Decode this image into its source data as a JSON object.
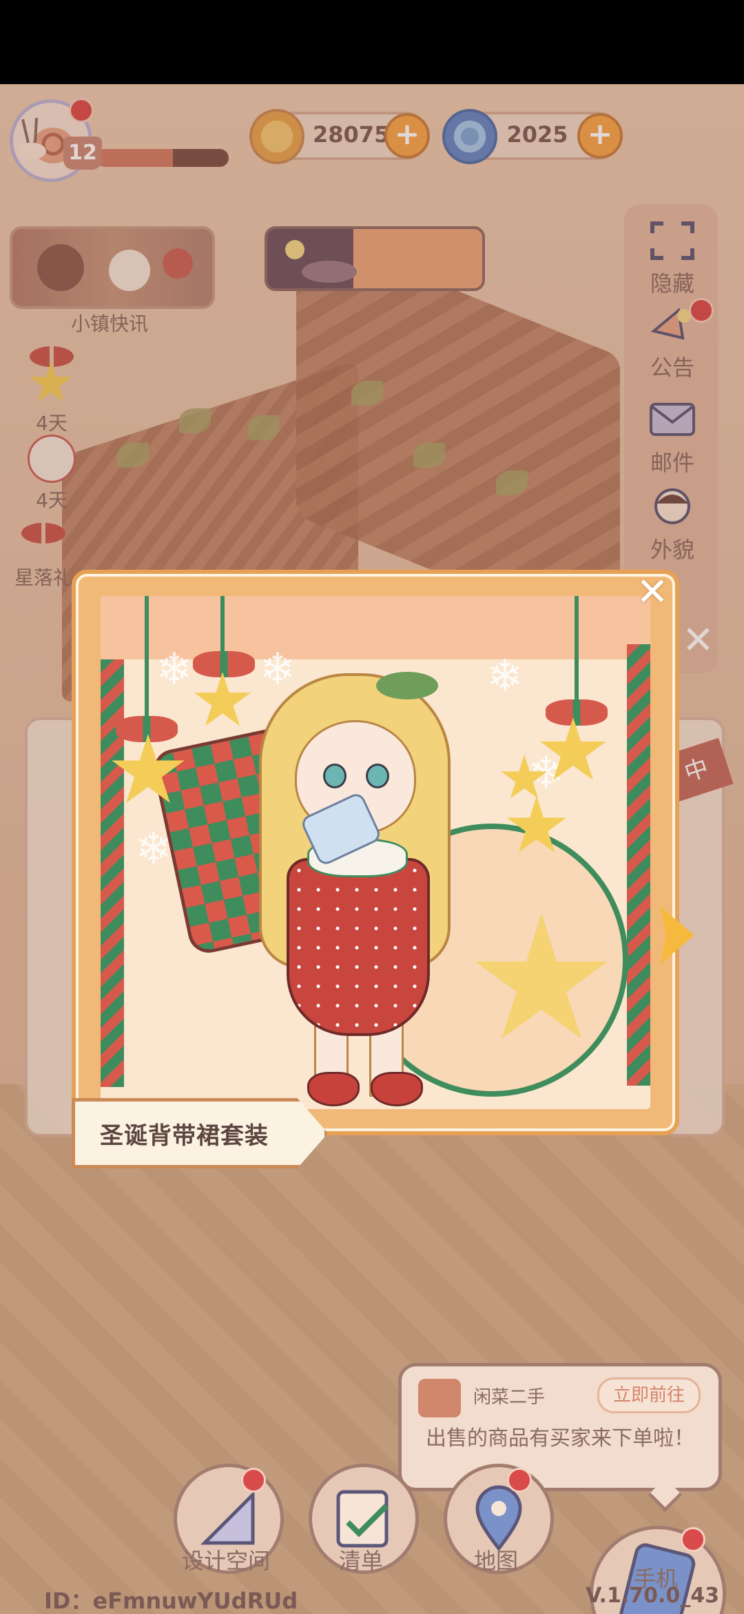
{
  "hud": {
    "level": "12",
    "xp_progress": 0.58,
    "coins": "28075",
    "gems": "2025",
    "plus": "+"
  },
  "left_panel": {
    "news_label": "小镇快讯",
    "events": [
      {
        "label": "4天",
        "icon": "star-gift-icon"
      },
      {
        "label": "4天",
        "icon": "cake-gift-icon"
      },
      {
        "label": "星落礼",
        "icon": "star-bow-gift-icon"
      }
    ]
  },
  "right_panel": {
    "buttons": [
      {
        "label": "隐藏",
        "icon": "hide-frame-icon"
      },
      {
        "label": "公告",
        "icon": "announcement-icon"
      },
      {
        "label": "邮件",
        "icon": "mail-icon"
      },
      {
        "label": "外貌",
        "icon": "appearance-icon"
      }
    ]
  },
  "modal": {
    "outfit_name": "圣诞背带裙套装",
    "close": "✕",
    "behind_card_tag": "中"
  },
  "toast": {
    "source": "闲菜二手",
    "action": "立即前往",
    "message": "出售的商品有买家来下单啦！"
  },
  "bottom_nav": {
    "design": "设计空间",
    "checklist": "清单",
    "map": "地图",
    "phone": "手机"
  },
  "footer": {
    "id_text": "ID：eFmnuwYUdRUd",
    "version": "V.1.70.0_43"
  },
  "colors": {
    "accent": "#f5a64b",
    "badge": "#d94a4a",
    "text": "#8b6b64"
  }
}
